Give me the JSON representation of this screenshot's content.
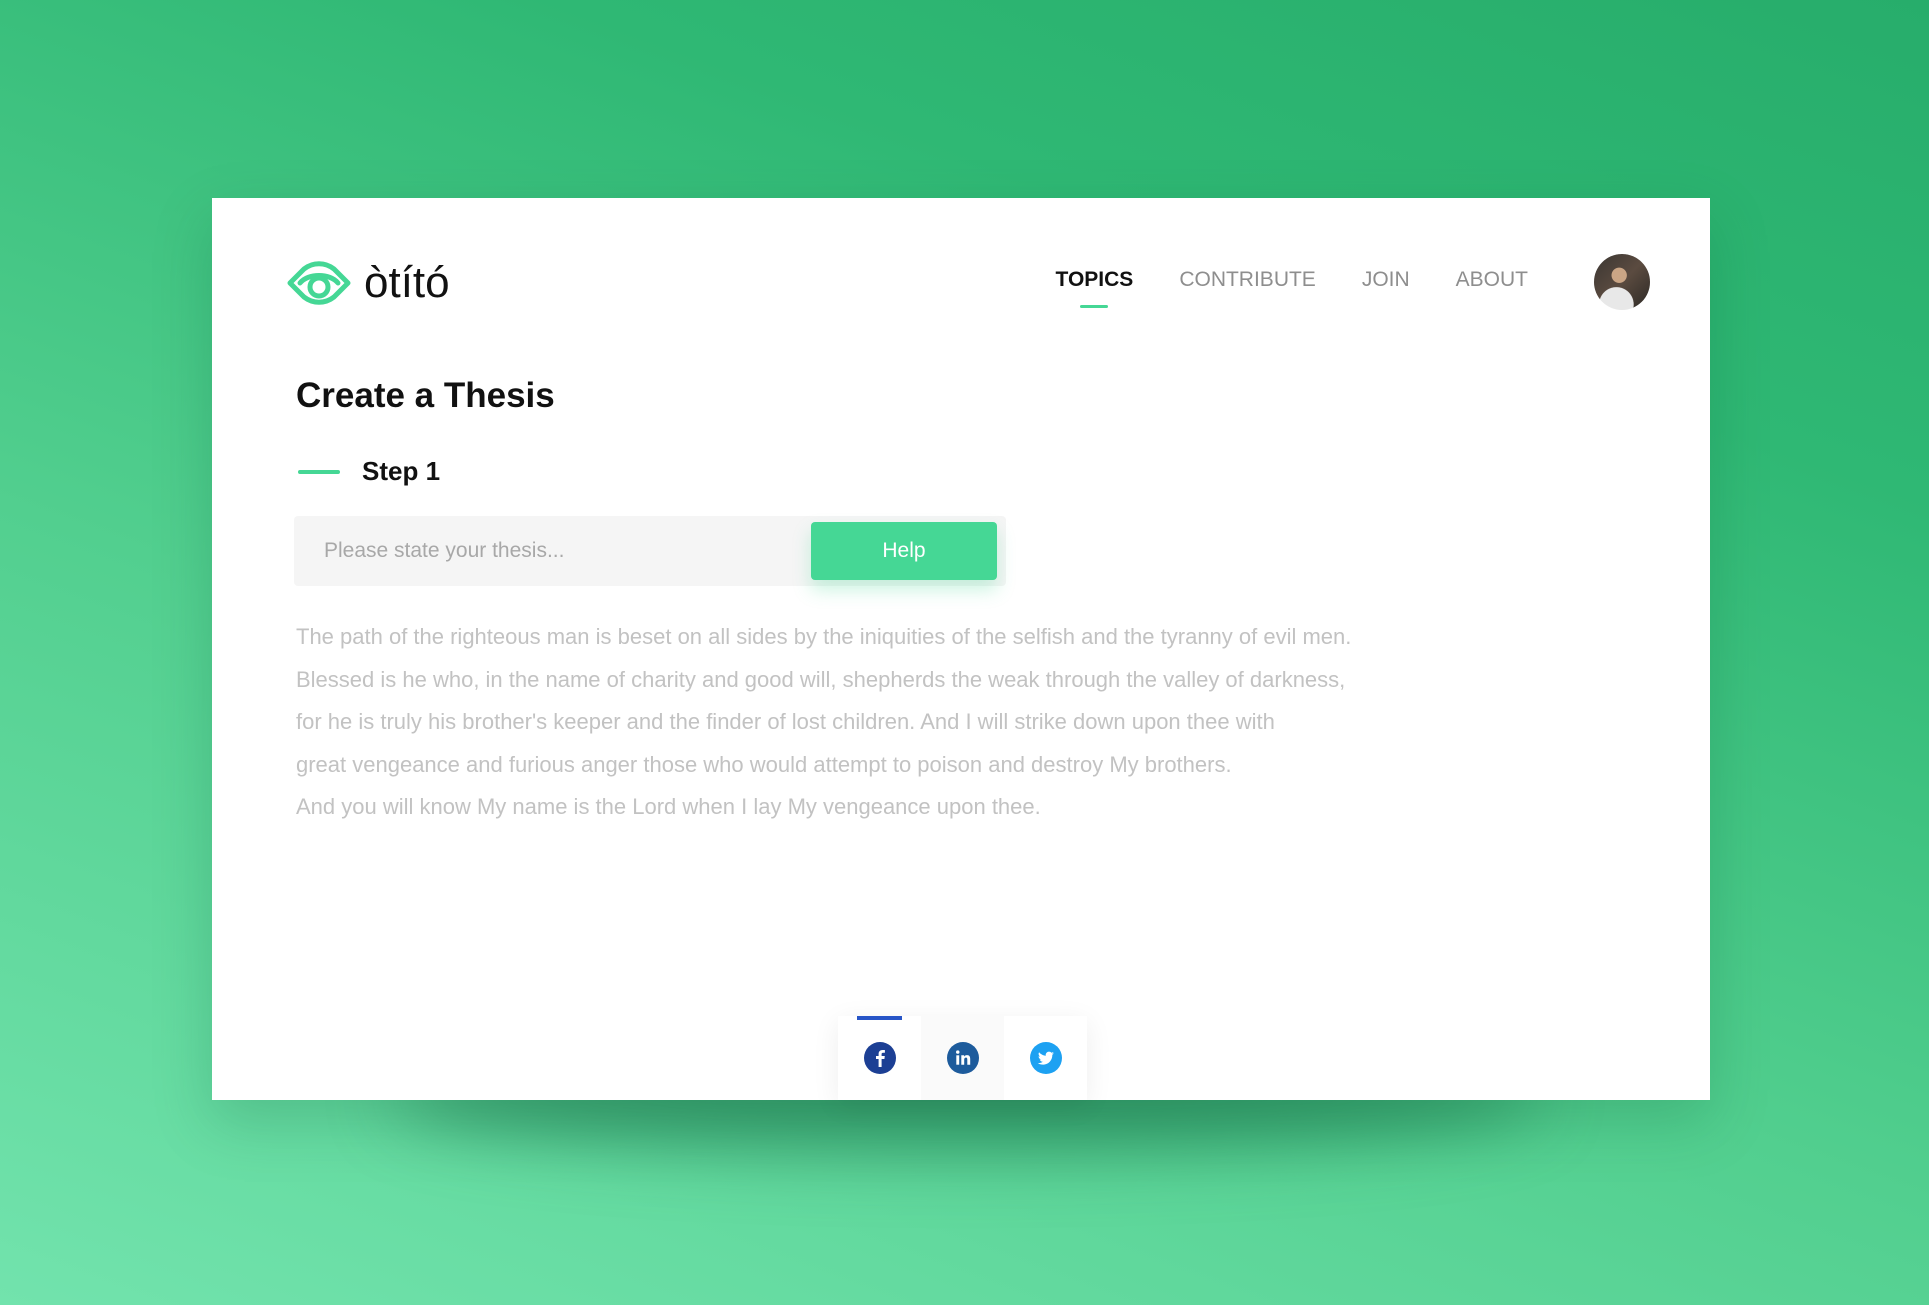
{
  "brand": {
    "name": "òtító",
    "accent_color": "#45d795",
    "logo_icon": "eye-logo-icon"
  },
  "nav": {
    "items": [
      {
        "label": "TOPICS",
        "active": true
      },
      {
        "label": "CONTRIBUTE",
        "active": false
      },
      {
        "label": "JOIN",
        "active": false
      },
      {
        "label": "ABOUT",
        "active": false
      }
    ],
    "avatar_icon": "user-avatar"
  },
  "page": {
    "title": "Create a Thesis",
    "step_label": "Step 1"
  },
  "thesis": {
    "placeholder": "Please state your thesis...",
    "value": "",
    "help_label": "Help"
  },
  "body_text": {
    "lines": [
      "The path of the righteous man is beset on all sides by the iniquities of the selfish and the tyranny of evil men.",
      "Blessed is he who, in the name of charity and good will, shepherds the weak through the valley of darkness,",
      "for he is truly his brother's keeper and the finder of lost children. And I will strike down upon thee with",
      "great vengeance and furious anger those who would attempt to poison and destroy My brothers.",
      "And you will know My name is the Lord when I lay My vengeance upon thee."
    ]
  },
  "share": {
    "items": [
      {
        "icon": "facebook-icon",
        "active": true,
        "color": "#1c3f94"
      },
      {
        "icon": "linkedin-icon",
        "active": false,
        "color": "#1d5b9c"
      },
      {
        "icon": "twitter-icon",
        "active": false,
        "color": "#1da1f2"
      }
    ]
  },
  "colors": {
    "background_start": "#72e3ad",
    "background_end": "#27ad6b",
    "card": "#ffffff",
    "text_primary": "#111111",
    "text_muted": "#c2c2c2",
    "nav_muted": "#8e8e8e",
    "share_active": "#2755c7"
  }
}
